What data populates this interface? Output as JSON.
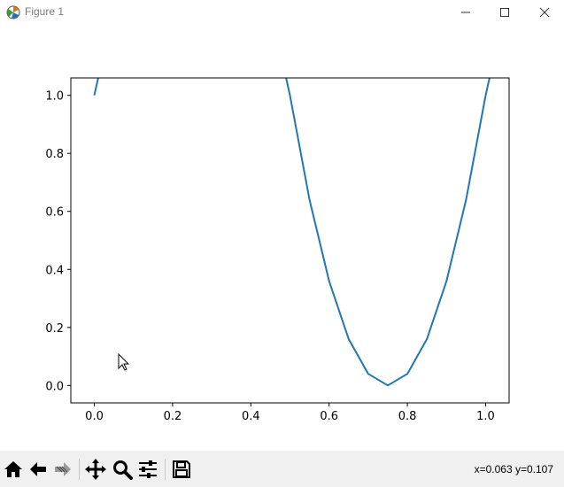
{
  "window": {
    "title": "Figure 1",
    "icons": {
      "app": "matplotlib-icon",
      "minimize": "minimize-icon",
      "maximize": "maximize-icon",
      "close": "close-icon"
    }
  },
  "toolbar": {
    "icons": [
      "home-icon",
      "back-arrow-icon",
      "forward-arrow-icon",
      "pan-icon",
      "zoom-icon",
      "configure-subplots-icon",
      "save-icon"
    ],
    "coords": "x=0.063 y=0.107"
  },
  "colors": {
    "line": "#1f77b4",
    "toolbar_bg": "#f0f0f0"
  },
  "chart_data": {
    "type": "line",
    "title": "",
    "xlabel": "",
    "ylabel": "",
    "xlim": [
      -0.06,
      1.06
    ],
    "ylim": [
      -0.06,
      1.06
    ],
    "xticks": [
      "0.0",
      "0.2",
      "0.4",
      "0.6",
      "0.8",
      "1.0"
    ],
    "yticks": [
      "0.0",
      "0.2",
      "0.4",
      "0.6",
      "0.8",
      "1.0"
    ],
    "grid": false,
    "series": [
      {
        "x": [
          0.0,
          0.005,
          0.01,
          0.49,
          0.5,
          0.55,
          0.6,
          0.65,
          0.7,
          0.75,
          0.8,
          0.85,
          0.9,
          0.95,
          1.0,
          1.01
        ],
        "y": [
          1.0,
          1.03,
          1.06,
          1.06,
          1.0,
          0.64,
          0.36,
          0.16,
          0.04,
          0.0,
          0.04,
          0.16,
          0.36,
          0.64,
          1.0,
          1.06
        ]
      }
    ]
  }
}
